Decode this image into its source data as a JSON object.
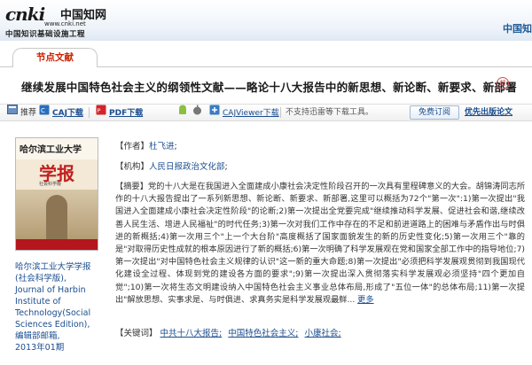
{
  "header": {
    "logo_text": "cnki",
    "logo_cn": "中国知网",
    "logo_url": "www.cnki.net",
    "slogan": "中国知识基础设施工程",
    "right_label": "中国知"
  },
  "tabs": {
    "active": "节点文献"
  },
  "article": {
    "title": "继续发展中国特色社会主义的纲领性文献——略论十八大报告中的新思想、新论断、新要求、新部署",
    "badge": "超"
  },
  "download_bar": {
    "recommend_label": "推荐",
    "caj_download": "CAJ下载",
    "pdf_download": "PDF下载",
    "cajviewer_download": "CAJViewer下载",
    "unsupported_text": "不支持迅雷等下载工具。",
    "free_order": "免费订阅",
    "priority_publish": "优先出版论文"
  },
  "journal": {
    "cover_name": "哈尔滨工业大学",
    "cover_big": "学报",
    "cover_sub": "社会科学版",
    "info_lines": [
      "哈尔滨工业大学学报",
      "(社会科学版)",
      ",",
      "Journal of Harbin",
      "Institute of",
      "Technology(Social",
      "Sciences Edition)",
      ",",
      "编辑部邮箱",
      ",",
      "2013年01期"
    ]
  },
  "details": {
    "author_label": "【作者】",
    "author": "杜飞进",
    "author_suffix": ";",
    "org_label": "【机构】",
    "org": "人民日报政治文化部",
    "org_suffix": ";",
    "abstract_label": "【摘要】",
    "abstract": "党的十八大是在我国进入全面建成小康社会决定性阶段召开的一次具有里程碑意义的大会。胡锦涛同志所作的十八大报告提出了一系列新思想、新论断、新要求、新部署,这里可以概括为72个\"第一次\":1)第一次提出\"我国进入全面建成小康社会决定性阶段\"的论断;2)第一次提出全党要完成\"继续推动科学发展、促进社会和谐,继续改善人民生活、增进人民福祉\"的时代任务;3)第一次对我们工作中存在的不足和前进道路上的困难与矛盾作出与时俱进的新概括;4)第一次用三个\"上一个大台阶\"高度概括了国家面貌发生的新的历史性变化;5)第一次用三个\"靠的是\"对取得历史性成就的根本原因进行了新的概括;6)第一次明确了科学发展观在党和国家全部工作中的指导地位;7)第一次提出\"对中国特色社会主义规律的认识\"这一新的重大命题;8)第一次提出\"必须把科学发展观贯彻到我国现代化建设全过程、体现到党的建设各方面的要求\";9)第一次提出深入贯彻落实科学发展观必须坚持\"四个更加自觉\";10)第一次将生态文明建设纳入中国特色社会主义事业总体布局,形成了\"五位一体\"的总体布局;11)第一次提出\"解放思想、实事求是、与时俱进、求真务实是科学发展观最鲜...",
    "more_link": "更多",
    "keywords_label": "【关键词】",
    "keywords": [
      "中共十八大报告;",
      "中国特色社会主义;",
      "小康社会;"
    ]
  },
  "colors": {
    "link": "#1a4d8f",
    "node_tab": "#cc2200"
  }
}
